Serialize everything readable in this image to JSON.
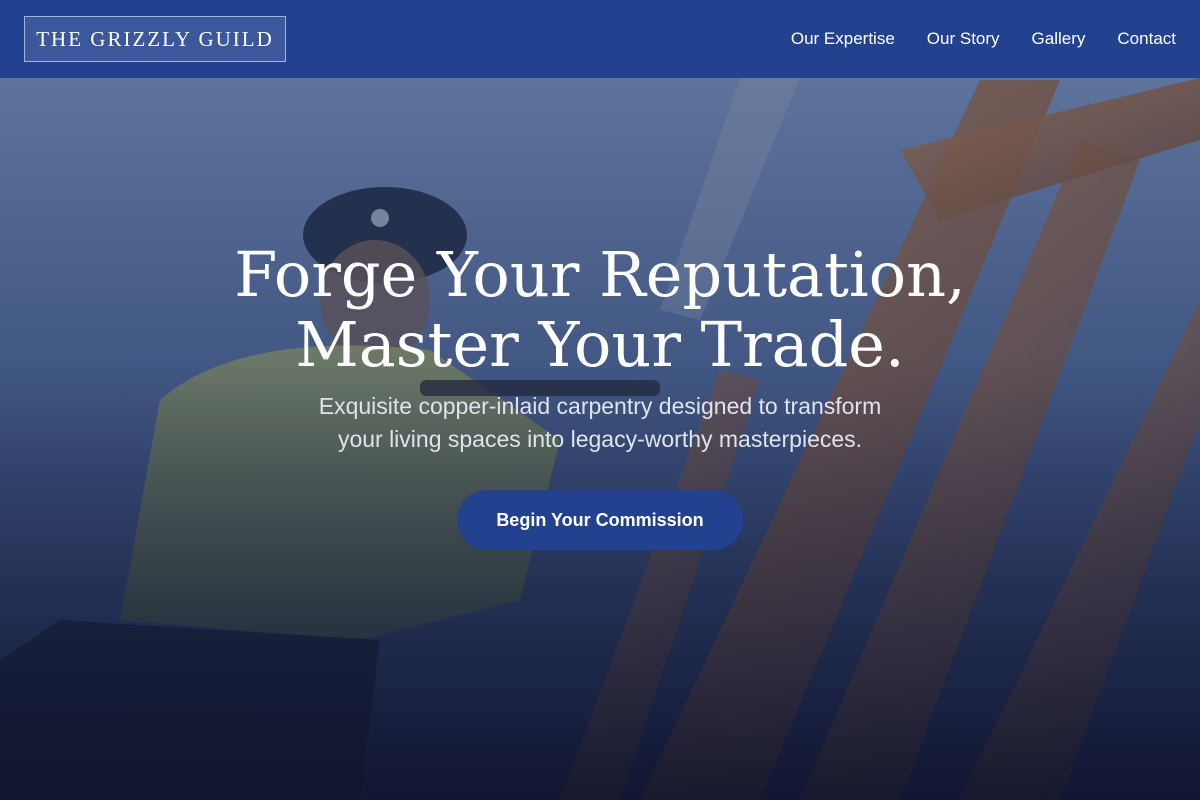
{
  "brand": {
    "logo_text": "THE GRIZZLY GUILD"
  },
  "nav": {
    "items": [
      {
        "label": "Our Expertise"
      },
      {
        "label": "Our Story"
      },
      {
        "label": "Gallery"
      },
      {
        "label": "Contact"
      }
    ]
  },
  "hero": {
    "headline_line1": "Forge Your Reputation,",
    "headline_line2": "Master Your Trade.",
    "subtext_line1": "Exquisite copper-inlaid carpentry designed to transform",
    "subtext_line2": "your living spaces into legacy-worthy masterpieces.",
    "cta_label": "Begin Your Commission",
    "background_image": "construction worker in hard hat framing timber"
  },
  "colors": {
    "nav_bg": "#22418f",
    "cta_bg": "#22418f",
    "text": "#ffffff"
  }
}
